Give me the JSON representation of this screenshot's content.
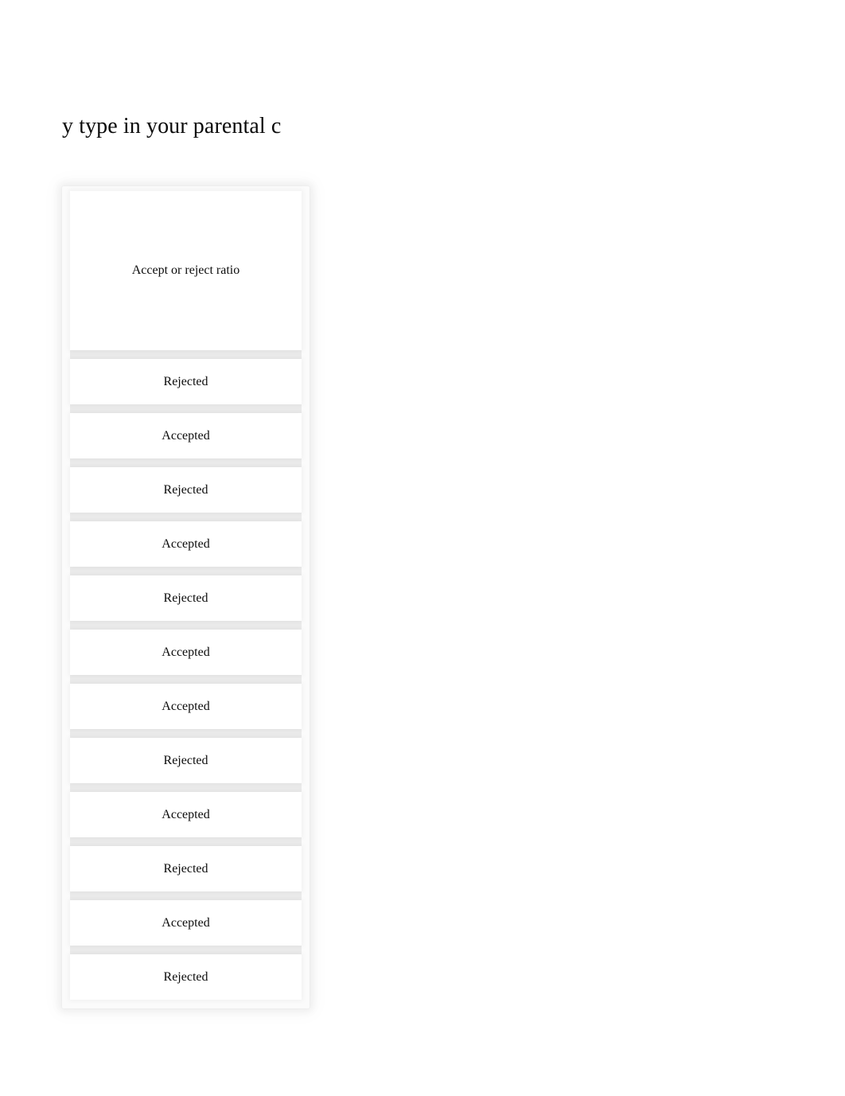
{
  "document": {
    "title": "y type in your parental c",
    "background_color": "#ffffff",
    "text_color": "#0c0c0c"
  },
  "table": {
    "name": "accept-or-reject-ratio-table",
    "header": {
      "label": "Accept or reject ratio"
    },
    "column_headers": [
      "Accept or reject ratio"
    ],
    "rows": [
      {
        "value": "Rejected"
      },
      {
        "value": "Accepted"
      },
      {
        "value": "Rejected"
      },
      {
        "value": "Accepted"
      },
      {
        "value": "Rejected"
      },
      {
        "value": "Accepted"
      },
      {
        "value": "Accepted"
      },
      {
        "value": "Rejected"
      },
      {
        "value": "Accepted"
      },
      {
        "value": "Rejected"
      },
      {
        "value": "Accepted"
      },
      {
        "value": "Rejected"
      }
    ],
    "separator_color": "#ebebeb",
    "cell_background": "#ffffff",
    "card_background": "#fbfbfb"
  }
}
